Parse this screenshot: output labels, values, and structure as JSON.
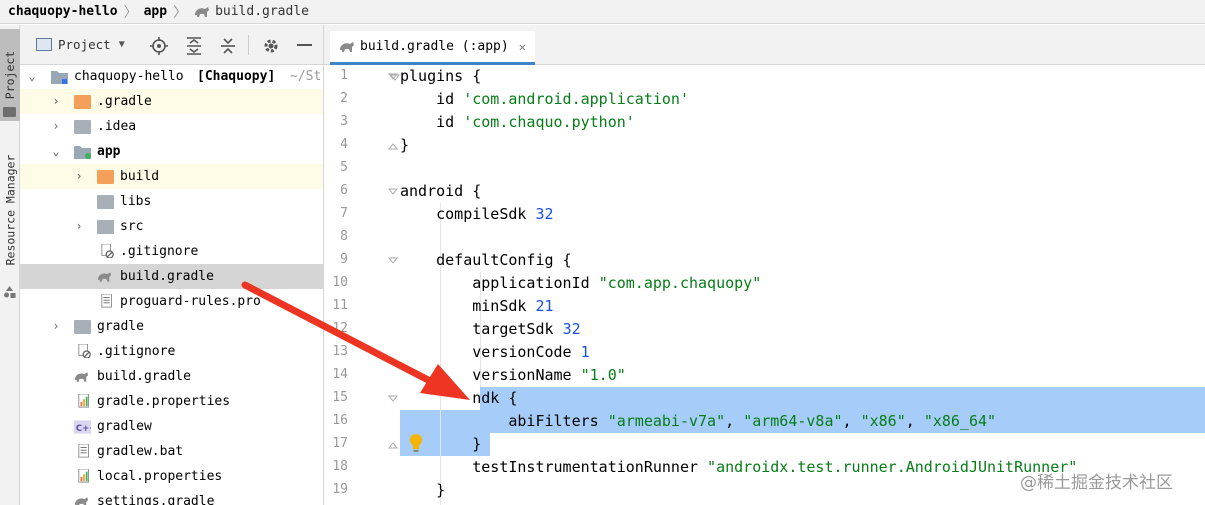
{
  "breadcrumb": {
    "root": "chaquopy-hello",
    "module": "app",
    "file": "build.gradle"
  },
  "side_tabs": {
    "project": "Project",
    "resource_manager": "Resource Manager"
  },
  "project_toolbar": {
    "view_label": "Project"
  },
  "tree": [
    {
      "label": "chaquopy-hello",
      "suffix": "[Chaquopy]",
      "path": "~/St",
      "chevron": "open"
    },
    {
      "label": ".gradle",
      "chevron": "closed"
    },
    {
      "label": ".idea",
      "chevron": "closed"
    },
    {
      "label": "app",
      "chevron": "open"
    },
    {
      "label": "build",
      "chevron": "closed"
    },
    {
      "label": "libs",
      "chevron": ""
    },
    {
      "label": "src",
      "chevron": "closed"
    },
    {
      "label": ".gitignore",
      "chevron": ""
    },
    {
      "label": "build.gradle",
      "chevron": ""
    },
    {
      "label": "proguard-rules.pro",
      "chevron": ""
    },
    {
      "label": "gradle",
      "chevron": "closed"
    },
    {
      "label": ".gitignore",
      "chevron": ""
    },
    {
      "label": "build.gradle",
      "chevron": ""
    },
    {
      "label": "gradle.properties",
      "chevron": ""
    },
    {
      "label": "gradlew",
      "chevron": ""
    },
    {
      "label": "gradlew.bat",
      "chevron": ""
    },
    {
      "label": "local.properties",
      "chevron": ""
    },
    {
      "label": "settings.gradle",
      "chevron": ""
    }
  ],
  "editor": {
    "tab_label": "build.gradle (:app)",
    "line_numbers": [
      "1",
      "2",
      "3",
      "4",
      "5",
      "6",
      "7",
      "8",
      "9",
      "10",
      "11",
      "12",
      "13",
      "14",
      "15",
      "16",
      "17",
      "18",
      "19"
    ],
    "lines": {
      "l1": {
        "a": "plugins {"
      },
      "l2": {
        "a": "    id ",
        "b": "'com.android.application'"
      },
      "l3": {
        "a": "    id ",
        "b": "'com.chaquo.python'"
      },
      "l4": {
        "a": "}"
      },
      "l6": {
        "a": "android {"
      },
      "l7": {
        "a": "    compileSdk ",
        "b": "32"
      },
      "l9": {
        "a": "    defaultConfig {"
      },
      "l10": {
        "a": "        applicationId ",
        "b": "\"com.app.chaquopy\""
      },
      "l11": {
        "a": "        minSdk ",
        "b": "21"
      },
      "l12": {
        "a": "        targetSdk ",
        "b": "32"
      },
      "l13": {
        "a": "        versionCode ",
        "b": "1"
      },
      "l14": {
        "a": "        versionName ",
        "b": "\"1.0\""
      },
      "l15": {
        "a": "        ndk {"
      },
      "l16": {
        "a": "            abiFilters ",
        "b": "\"armeabi-v7a\"",
        "c": ", ",
        "d": "\"arm64-v8a\"",
        "e": ", ",
        "f": "\"x86\"",
        "g": ", ",
        "h": "\"x86_64\""
      },
      "l17": {
        "a": "        }"
      },
      "l18": {
        "a": "        testInstrumentationRunner ",
        "b": "\"androidx.test.runner.AndroidJUnitRunner\""
      },
      "l19": {
        "a": "    }"
      }
    }
  },
  "watermark": "@稀土掘金技术社区",
  "colors": {
    "selection": "#a6ccf9",
    "string": "#067d17",
    "number": "#1750eb",
    "arrow": "#ee3523",
    "highlight_row": "#fefbe6"
  }
}
